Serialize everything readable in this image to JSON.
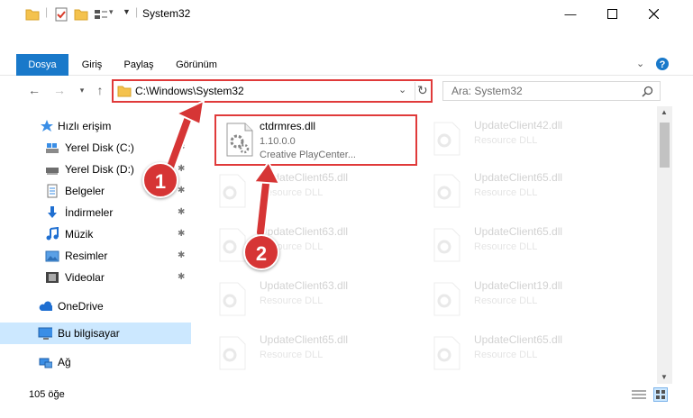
{
  "window": {
    "title": "System32",
    "controls": [
      "minimize-icon",
      "maximize-icon",
      "close-icon"
    ]
  },
  "ribbon": {
    "tabs": [
      "Dosya",
      "Giriş",
      "Paylaş",
      "Görünüm"
    ]
  },
  "address": {
    "path": "C:\\Windows\\System32"
  },
  "search": {
    "placeholder": "Ara: System32"
  },
  "sidebar": {
    "items": [
      {
        "label": "Hızlı erişim",
        "icon": "star-icon"
      },
      {
        "label": "Yerel Disk (C:)",
        "icon": "drive-icon"
      },
      {
        "label": "Yerel Disk (D:)",
        "icon": "drive-icon"
      },
      {
        "label": "Belgeler",
        "icon": "documents-icon"
      },
      {
        "label": "İndirmeler",
        "icon": "download-icon"
      },
      {
        "label": "Müzik",
        "icon": "music-icon"
      },
      {
        "label": "Resimler",
        "icon": "pictures-icon"
      },
      {
        "label": "Videolar",
        "icon": "videos-icon"
      },
      {
        "label": "OneDrive",
        "icon": "cloud-icon"
      },
      {
        "label": "Bu bilgisayar",
        "icon": "computer-icon"
      },
      {
        "label": "Ağ",
        "icon": "network-icon"
      }
    ]
  },
  "files": {
    "highlighted": {
      "name": "ctdrmres.dll",
      "version": "1.10.0.0",
      "company": "Creative PlayCenter..."
    },
    "left": [
      {
        "name": "UpdateClient65.dll",
        "type": "Resource DLL"
      },
      {
        "name": "UpdateClient63.dll",
        "type": "Resource DLL"
      },
      {
        "name": "UpdateClient63.dll",
        "type": "Resource DLL"
      },
      {
        "name": "UpdateClient65.dll",
        "type": "Resource DLL"
      }
    ],
    "right": [
      {
        "name": "UpdateClient42.dll",
        "type": "Resource DLL"
      },
      {
        "name": "UpdateClient65.dll",
        "type": "Resource DLL"
      },
      {
        "name": "UpdateClient65.dll",
        "type": "Resource DLL"
      },
      {
        "name": "UpdateClient19.dll",
        "type": "Resource DLL"
      },
      {
        "name": "UpdateClient65.dll",
        "type": "Resource DLL"
      }
    ]
  },
  "status": {
    "count": "105 öğe"
  },
  "annotations": {
    "step1": "1",
    "step2": "2",
    "color": "#d63535"
  }
}
